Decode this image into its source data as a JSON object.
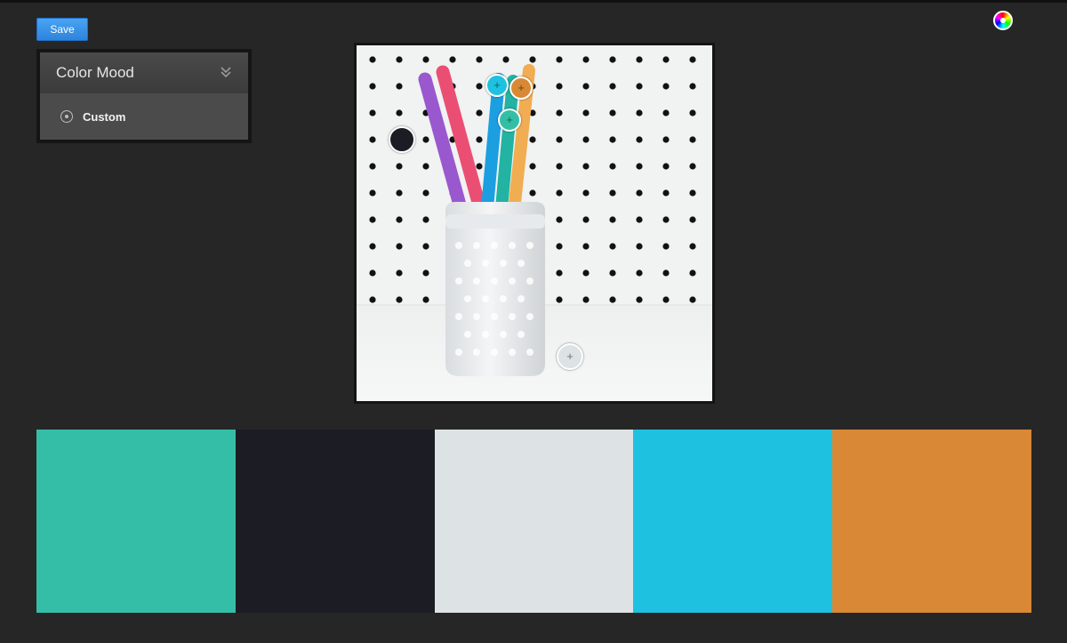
{
  "toolbar": {
    "save_label": "Save",
    "color_wheel_icon": "color-wheel-icon"
  },
  "mood_panel": {
    "title": "Color Mood",
    "expand_icon": "double-chevron-down-icon",
    "options": [
      {
        "label": "Custom",
        "selected": true
      }
    ]
  },
  "image": {
    "subject": "Colored straws in a milk glass jar in front of a white pegboard"
  },
  "pickers": [
    {
      "color": "#1fc1e0",
      "label": "+"
    },
    {
      "color": "#d98835",
      "label": "+"
    },
    {
      "color": "#33bfa5",
      "label": "+"
    },
    {
      "color": "#1b1c24",
      "label": ""
    },
    {
      "color": "#dde2e4",
      "label": "+"
    }
  ],
  "swatches": [
    {
      "color": "#35bea7"
    },
    {
      "color": "#1b1c24"
    },
    {
      "color": "#dde2e4"
    },
    {
      "color": "#1fc1e0"
    },
    {
      "color": "#d98835"
    }
  ]
}
